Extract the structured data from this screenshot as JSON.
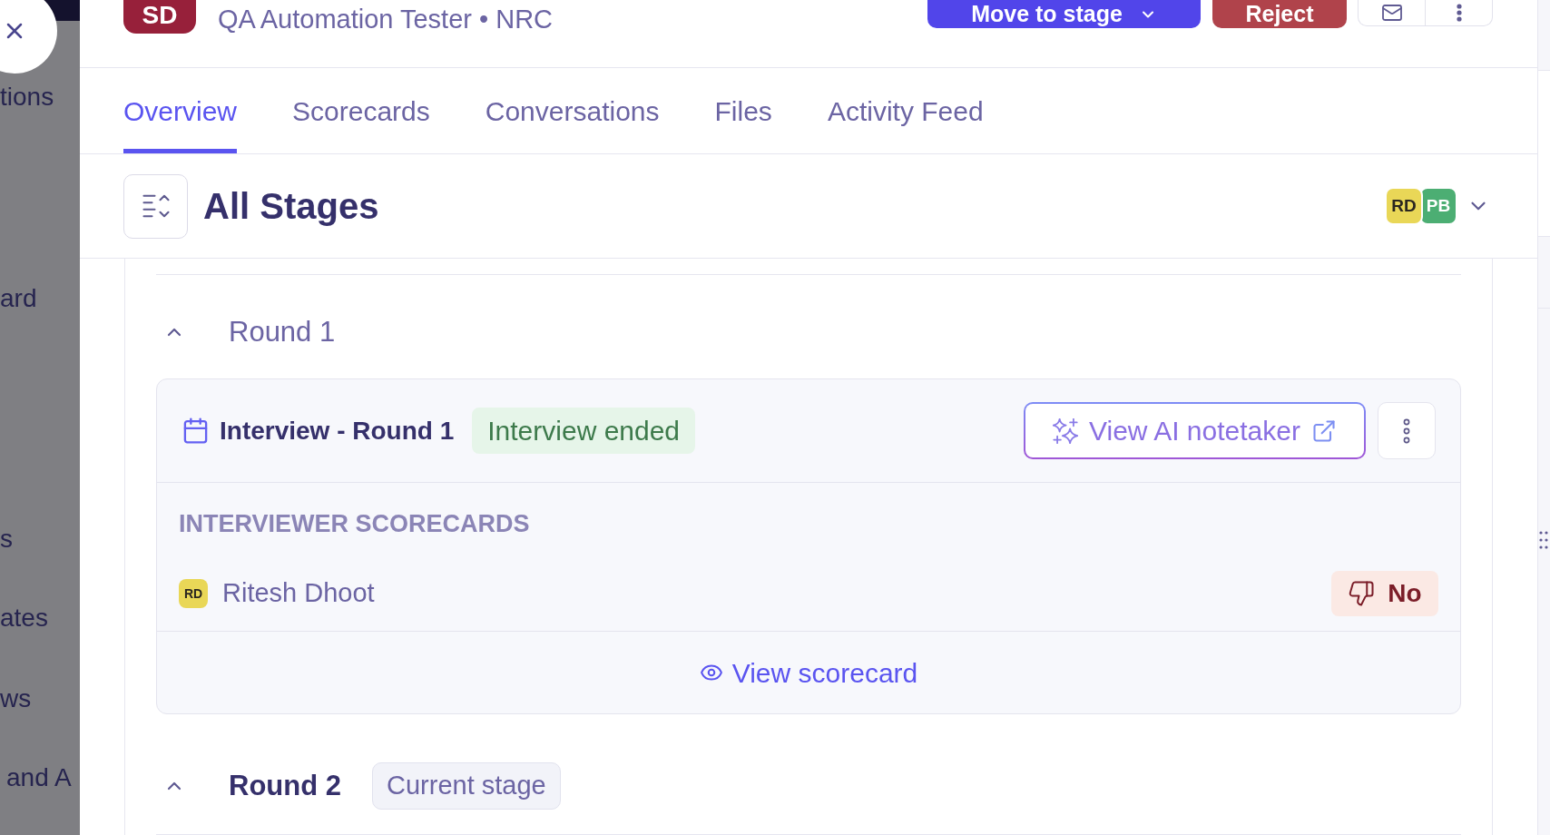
{
  "backdrop": {
    "items": [
      "tions",
      "ard",
      "s",
      "ates",
      "ws",
      "and A"
    ]
  },
  "candidate": {
    "initials": "SD",
    "subtitle": "QA Automation Tester • NRC"
  },
  "actions": {
    "move_to_stage": "Move to stage",
    "reject": "Reject"
  },
  "tabs": [
    {
      "label": "Overview",
      "selected": true
    },
    {
      "label": "Scorecards",
      "selected": false
    },
    {
      "label": "Conversations",
      "selected": false
    },
    {
      "label": "Files",
      "selected": false
    },
    {
      "label": "Activity Feed",
      "selected": false
    }
  ],
  "stages": {
    "title": "All Stages",
    "participants": [
      {
        "initials": "RD",
        "color": "#e9d757"
      },
      {
        "initials": "PB",
        "color": "#4cae73"
      }
    ],
    "rounds": [
      {
        "title": "Round 1",
        "expanded": true,
        "current": false,
        "interviews": [
          {
            "title": "Interview - Round 1",
            "status": "Interview ended",
            "ai_notetaker": "View AI notetaker",
            "scorecards_label": "INTERVIEWER SCORECARDS",
            "scorecards": [
              {
                "initials": "RD",
                "color": "#e9d757",
                "name": "Ritesh Dhoot",
                "recommendation": {
                  "kind": "no",
                  "label": "No"
                }
              }
            ],
            "view_link": "View scorecard"
          }
        ]
      },
      {
        "title": "Round 2",
        "expanded": true,
        "current": true,
        "badge": "Current stage"
      }
    ]
  }
}
